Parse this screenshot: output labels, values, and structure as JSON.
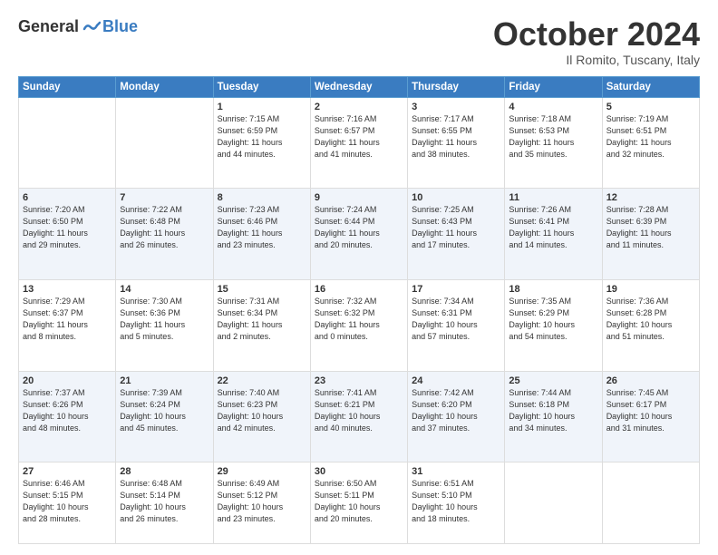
{
  "header": {
    "logo": {
      "part1": "General",
      "part2": "Blue"
    },
    "title": "October 2024",
    "location": "Il Romito, Tuscany, Italy"
  },
  "weekdays": [
    "Sunday",
    "Monday",
    "Tuesday",
    "Wednesday",
    "Thursday",
    "Friday",
    "Saturday"
  ],
  "weeks": [
    [
      null,
      null,
      {
        "day": 1,
        "sunrise": "7:15 AM",
        "sunset": "6:59 PM",
        "daylight": "11 hours and 44 minutes."
      },
      {
        "day": 2,
        "sunrise": "7:16 AM",
        "sunset": "6:57 PM",
        "daylight": "11 hours and 41 minutes."
      },
      {
        "day": 3,
        "sunrise": "7:17 AM",
        "sunset": "6:55 PM",
        "daylight": "11 hours and 38 minutes."
      },
      {
        "day": 4,
        "sunrise": "7:18 AM",
        "sunset": "6:53 PM",
        "daylight": "11 hours and 35 minutes."
      },
      {
        "day": 5,
        "sunrise": "7:19 AM",
        "sunset": "6:51 PM",
        "daylight": "11 hours and 32 minutes."
      }
    ],
    [
      {
        "day": 6,
        "sunrise": "7:20 AM",
        "sunset": "6:50 PM",
        "daylight": "11 hours and 29 minutes."
      },
      {
        "day": 7,
        "sunrise": "7:22 AM",
        "sunset": "6:48 PM",
        "daylight": "11 hours and 26 minutes."
      },
      {
        "day": 8,
        "sunrise": "7:23 AM",
        "sunset": "6:46 PM",
        "daylight": "11 hours and 23 minutes."
      },
      {
        "day": 9,
        "sunrise": "7:24 AM",
        "sunset": "6:44 PM",
        "daylight": "11 hours and 20 minutes."
      },
      {
        "day": 10,
        "sunrise": "7:25 AM",
        "sunset": "6:43 PM",
        "daylight": "11 hours and 17 minutes."
      },
      {
        "day": 11,
        "sunrise": "7:26 AM",
        "sunset": "6:41 PM",
        "daylight": "11 hours and 14 minutes."
      },
      {
        "day": 12,
        "sunrise": "7:28 AM",
        "sunset": "6:39 PM",
        "daylight": "11 hours and 11 minutes."
      }
    ],
    [
      {
        "day": 13,
        "sunrise": "7:29 AM",
        "sunset": "6:37 PM",
        "daylight": "11 hours and 8 minutes."
      },
      {
        "day": 14,
        "sunrise": "7:30 AM",
        "sunset": "6:36 PM",
        "daylight": "11 hours and 5 minutes."
      },
      {
        "day": 15,
        "sunrise": "7:31 AM",
        "sunset": "6:34 PM",
        "daylight": "11 hours and 2 minutes."
      },
      {
        "day": 16,
        "sunrise": "7:32 AM",
        "sunset": "6:32 PM",
        "daylight": "11 hours and 0 minutes."
      },
      {
        "day": 17,
        "sunrise": "7:34 AM",
        "sunset": "6:31 PM",
        "daylight": "10 hours and 57 minutes."
      },
      {
        "day": 18,
        "sunrise": "7:35 AM",
        "sunset": "6:29 PM",
        "daylight": "10 hours and 54 minutes."
      },
      {
        "day": 19,
        "sunrise": "7:36 AM",
        "sunset": "6:28 PM",
        "daylight": "10 hours and 51 minutes."
      }
    ],
    [
      {
        "day": 20,
        "sunrise": "7:37 AM",
        "sunset": "6:26 PM",
        "daylight": "10 hours and 48 minutes."
      },
      {
        "day": 21,
        "sunrise": "7:39 AM",
        "sunset": "6:24 PM",
        "daylight": "10 hours and 45 minutes."
      },
      {
        "day": 22,
        "sunrise": "7:40 AM",
        "sunset": "6:23 PM",
        "daylight": "10 hours and 42 minutes."
      },
      {
        "day": 23,
        "sunrise": "7:41 AM",
        "sunset": "6:21 PM",
        "daylight": "10 hours and 40 minutes."
      },
      {
        "day": 24,
        "sunrise": "7:42 AM",
        "sunset": "6:20 PM",
        "daylight": "10 hours and 37 minutes."
      },
      {
        "day": 25,
        "sunrise": "7:44 AM",
        "sunset": "6:18 PM",
        "daylight": "10 hours and 34 minutes."
      },
      {
        "day": 26,
        "sunrise": "7:45 AM",
        "sunset": "6:17 PM",
        "daylight": "10 hours and 31 minutes."
      }
    ],
    [
      {
        "day": 27,
        "sunrise": "6:46 AM",
        "sunset": "5:15 PM",
        "daylight": "10 hours and 28 minutes."
      },
      {
        "day": 28,
        "sunrise": "6:48 AM",
        "sunset": "5:14 PM",
        "daylight": "10 hours and 26 minutes."
      },
      {
        "day": 29,
        "sunrise": "6:49 AM",
        "sunset": "5:12 PM",
        "daylight": "10 hours and 23 minutes."
      },
      {
        "day": 30,
        "sunrise": "6:50 AM",
        "sunset": "5:11 PM",
        "daylight": "10 hours and 20 minutes."
      },
      {
        "day": 31,
        "sunrise": "6:51 AM",
        "sunset": "5:10 PM",
        "daylight": "10 hours and 18 minutes."
      },
      null,
      null
    ]
  ]
}
